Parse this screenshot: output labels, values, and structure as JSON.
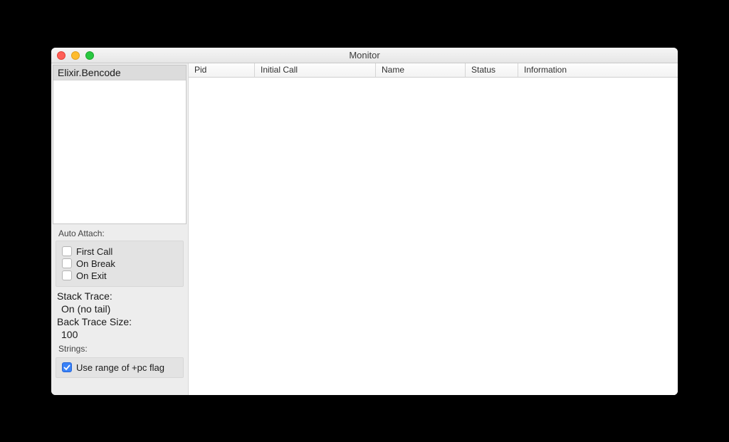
{
  "window": {
    "title": "Monitor"
  },
  "sidebar": {
    "modules": [
      "Elixir.Bencode"
    ],
    "autoAttach": {
      "label": "Auto Attach:",
      "items": [
        {
          "label": "First Call",
          "checked": false
        },
        {
          "label": "On Break",
          "checked": false
        },
        {
          "label": "On Exit",
          "checked": false
        }
      ]
    },
    "stackTrace": {
      "label": "Stack Trace:",
      "value": "On (no tail)"
    },
    "backTrace": {
      "label": "Back Trace Size:",
      "value": "100"
    },
    "strings": {
      "label": "Strings:",
      "option": {
        "label": "Use range of +pc flag",
        "checked": true
      }
    }
  },
  "table": {
    "columns": [
      "Pid",
      "Initial Call",
      "Name",
      "Status",
      "Information"
    ],
    "widths": [
      93,
      170,
      126,
      74,
      220
    ],
    "rows": []
  }
}
